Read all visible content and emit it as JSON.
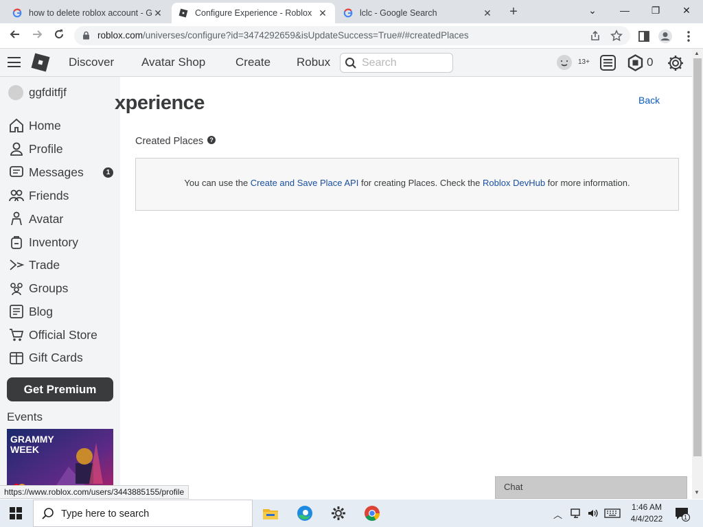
{
  "browser": {
    "tabs": [
      {
        "title": "how to delete roblox account - G",
        "active": false
      },
      {
        "title": "Configure Experience - Roblox",
        "active": true
      },
      {
        "title": "lclc - Google Search",
        "active": false
      }
    ],
    "url_main": "roblox.com",
    "url_rest": "/universes/configure?id=3474292659&isUpdateSuccess=True#/#createdPlaces",
    "new_tab": "+",
    "win_min": "—",
    "win_max": "❐",
    "win_close": "✕",
    "tab_menu": "⌄"
  },
  "header": {
    "nav": [
      "Discover",
      "Avatar Shop",
      "Create",
      "Robux"
    ],
    "search_placeholder": "Search",
    "age_badge": "13+",
    "robux_count": "0"
  },
  "sidebar": {
    "username": "ggfditfjf",
    "items": [
      {
        "label": "Home",
        "icon": "home-icon"
      },
      {
        "label": "Profile",
        "icon": "profile-icon"
      },
      {
        "label": "Messages",
        "icon": "messages-icon",
        "count": "1"
      },
      {
        "label": "Friends",
        "icon": "friends-icon"
      },
      {
        "label": "Avatar",
        "icon": "avatar-icon"
      },
      {
        "label": "Inventory",
        "icon": "inventory-icon"
      },
      {
        "label": "Trade",
        "icon": "trade-icon"
      },
      {
        "label": "Groups",
        "icon": "groups-icon"
      },
      {
        "label": "Blog",
        "icon": "blog-icon"
      },
      {
        "label": "Official Store",
        "icon": "store-icon"
      },
      {
        "label": "Gift Cards",
        "icon": "gift-card-icon"
      }
    ],
    "premium_button": "Get Premium",
    "events_heading": "Events",
    "event_banner_line1": "GRAMMY",
    "event_banner_line2": "WEEK"
  },
  "main": {
    "page_title": "xperience",
    "back_link": "Back",
    "section_title": "Created Places",
    "info_prefix": "You can use the ",
    "info_link1": "Create and Save Place API",
    "info_middle": " for creating Places. Check the ",
    "info_link2": "Roblox DevHub",
    "info_suffix": " for more information."
  },
  "chat": {
    "label": "Chat"
  },
  "status_url": "https://www.roblox.com/users/3443885155/profile",
  "taskbar": {
    "search_placeholder": "Type here to search",
    "time": "1:46 AM",
    "date": "4/4/2022",
    "notification_count": "1"
  },
  "colors": {
    "roblox_nav_bg": "#f2f4f5",
    "text_dark": "#393b3d",
    "link_blue": "#1a4fa0",
    "taskbar_bg": "#e6ecf4"
  }
}
